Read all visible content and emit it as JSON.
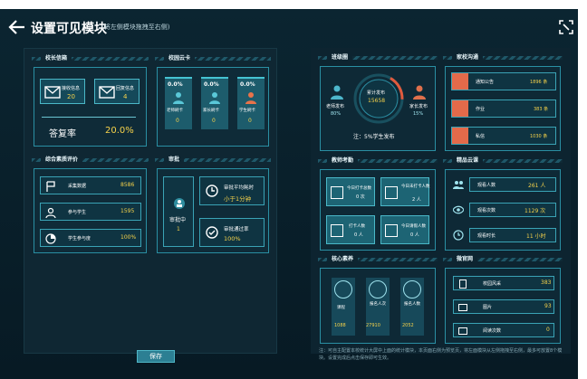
{
  "header": {
    "title": "设置可见模块",
    "subtitle": "(将左侧模块拖拽至右侧)"
  },
  "left": {
    "principal": {
      "title": "校长信箱",
      "received_label": "接收信息",
      "received_value": "20",
      "replied_label": "回复信息",
      "replied_value": "4",
      "rate_label": "答复率",
      "rate_value": "20.0%"
    },
    "campus": {
      "title": "校园云卡",
      "items": [
        {
          "pct": "0.0%",
          "label": "老师刷卡",
          "value": "0"
        },
        {
          "pct": "0.0%",
          "label": "家长刷卡",
          "value": "0"
        },
        {
          "pct": "0.0%",
          "label": "学生刷卡",
          "value": "0"
        }
      ]
    },
    "evaluation": {
      "title": "综合素质评价",
      "rows": [
        {
          "label": "采集数据",
          "value": "8586"
        },
        {
          "label": "参与学生",
          "value": "1595"
        },
        {
          "label": "学生参与度",
          "value": "100%"
        }
      ]
    },
    "approval": {
      "title": "审批",
      "pending_label": "审批中",
      "pending_value": "1",
      "avg_label": "审批平均耗时",
      "avg_value": "小于1分钟",
      "rate_label": "审批通过率",
      "rate_value": "100%"
    }
  },
  "right": {
    "class_circle": {
      "title": "班级圈",
      "teacher_label": "老师发布",
      "teacher_pct": "80%",
      "total_label": "累计发布",
      "total_value": "15658",
      "parent_label": "家长发布",
      "parent_pct": "15%",
      "note": "注：5%学生发布"
    },
    "home_school": {
      "title": "家校沟通",
      "rows": [
        {
          "label": "通知公告",
          "value": "1896 条"
        },
        {
          "label": "作业",
          "value": "383 条"
        },
        {
          "label": "私信",
          "value": "1030 条"
        }
      ]
    },
    "attendance": {
      "title": "教师考勤",
      "tiles": [
        {
          "label": "今日打卡总数",
          "value": "0 次"
        },
        {
          "label": "今日未打卡人数",
          "value": "2 人"
        },
        {
          "label": "打卡人数",
          "value": "0 人"
        },
        {
          "label": "今日请假人数",
          "value": "0 人"
        }
      ]
    },
    "boutique": {
      "title": "精品云课",
      "rows": [
        {
          "label": "观看人数",
          "value": "261 人"
        },
        {
          "label": "观看次数",
          "value": "1129 次"
        },
        {
          "label": "观看时长",
          "value": "11 小时"
        }
      ]
    },
    "literacy": {
      "title": "核心素养",
      "items": [
        {
          "label": "课程",
          "value": "1088"
        },
        {
          "label": "报名人次",
          "value": "27910"
        },
        {
          "label": "报名人数",
          "value": "2052"
        }
      ]
    },
    "micro_site": {
      "title": "微官网",
      "rows": [
        {
          "label": "校园风采",
          "value": "383"
        },
        {
          "label": "图片",
          "value": "93"
        },
        {
          "label": "阅读次数",
          "value": "0"
        }
      ]
    }
  },
  "footer": {
    "save_label": "保存",
    "note": "注：可自主配置本校统计大屏中上面的统计模块，本页面右侧为预览页，将左面模块从左侧拖拽至右侧，最多可放置8个模块。设置完成后点击保存即可生效。"
  }
}
